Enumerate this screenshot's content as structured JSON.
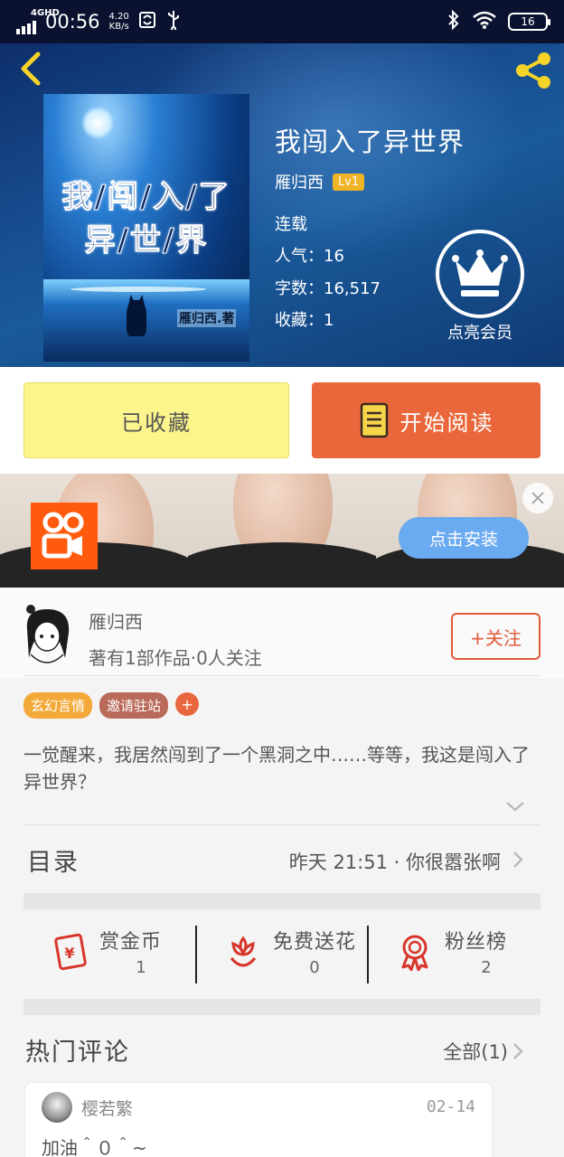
{
  "status_bar": {
    "network": "4GHD",
    "time": "00:56",
    "speed_value": "4.20",
    "speed_unit": "KB/s",
    "battery": "16"
  },
  "book": {
    "title": "我闯入了异世界",
    "author": "雁归西",
    "level": "Lv1",
    "status": "连载",
    "popularity": "人气：16",
    "word_count": "字数：16,517",
    "favorites": "收藏：1",
    "vip_label": "点亮会员",
    "cover": {
      "title_line1": "我/闯/入/了",
      "title_line2": "异/世/界",
      "author_mark": "雁归西.著"
    }
  },
  "actions": {
    "favorite_label": "已收藏",
    "read_label": "开始阅读"
  },
  "ad": {
    "install_label": "点击安装"
  },
  "author_card": {
    "name": "雁归西",
    "works": "著有1部作品·0人关注",
    "follow_label": "+关注"
  },
  "tags": [
    "玄幻言情",
    "邀请驻站",
    "+"
  ],
  "synopsis": "一觉醒来，我居然闯到了一个黑洞之中……等等，我这是闯入了异世界？",
  "toc": {
    "title": "目录",
    "latest": "昨天 21:51 · 你很嚣张啊"
  },
  "rewards": [
    {
      "label": "赏金币",
      "count": "1"
    },
    {
      "label": "免费送花",
      "count": "0"
    },
    {
      "label": "粉丝榜",
      "count": "2"
    }
  ],
  "comments": {
    "title": "热门评论",
    "all_label": "全部(1)",
    "items": [
      {
        "user": "樱若繁",
        "date": "02-14",
        "text": "加油＾０＾~"
      }
    ]
  },
  "colors": {
    "accent_orange": "#e9673b",
    "favorite_yellow": "#fbf58c",
    "hero_blue": "#174c8f",
    "install_blue": "#6aaaf0"
  }
}
